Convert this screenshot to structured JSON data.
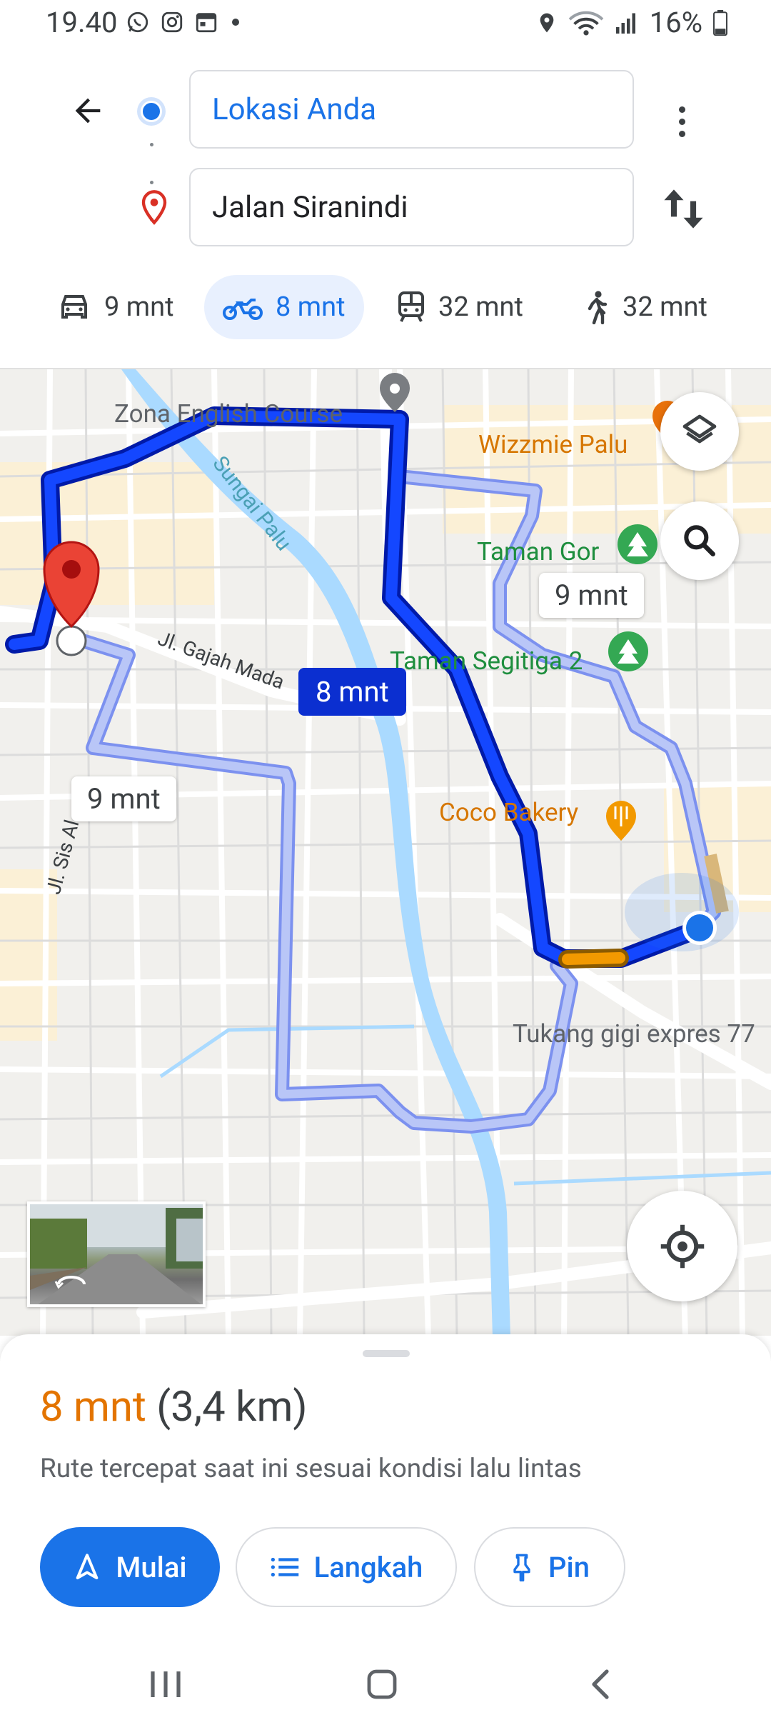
{
  "status_bar": {
    "time": "19.40",
    "battery": "16%"
  },
  "header": {
    "origin": "Lokasi Anda",
    "destination": "Jalan Siranindi",
    "modes": [
      {
        "label": "9 mnt",
        "icon": "car-icon"
      },
      {
        "label": "8 mnt",
        "icon": "motorcycle-icon"
      },
      {
        "label": "32 mnt",
        "icon": "transit-icon"
      },
      {
        "label": "32 mnt",
        "icon": "walk-icon"
      }
    ]
  },
  "map": {
    "labels": {
      "zona": "Zona English Course",
      "wizzmie": "Wizzmie Palu",
      "sungai": "Sungai Palu",
      "taman_gor": "Taman Gor",
      "taman_segitiga": "Taman Segitiga 2",
      "coco": "Coco Bakery",
      "gajah_mada": "Jl. Gajah Mada",
      "sis_al": "Jl. Sis Al",
      "tukang": "Tukang gigi expres 77"
    },
    "route_times": {
      "primary": "8 mnt",
      "alt_left": "9 mnt",
      "alt_right": "9 mnt"
    },
    "colors": {
      "route_primary": "#0b2fd0",
      "route_alt": "#a9b8f5",
      "traffic": "#f29900",
      "river": "#aadaff"
    }
  },
  "sheet": {
    "time": "8 mnt",
    "distance": "(3,4 km)",
    "subtitle": "Rute tercepat saat ini sesuai kondisi lalu lintas",
    "start_label": "Mulai",
    "steps_label": "Langkah",
    "pin_label": "Pin"
  }
}
